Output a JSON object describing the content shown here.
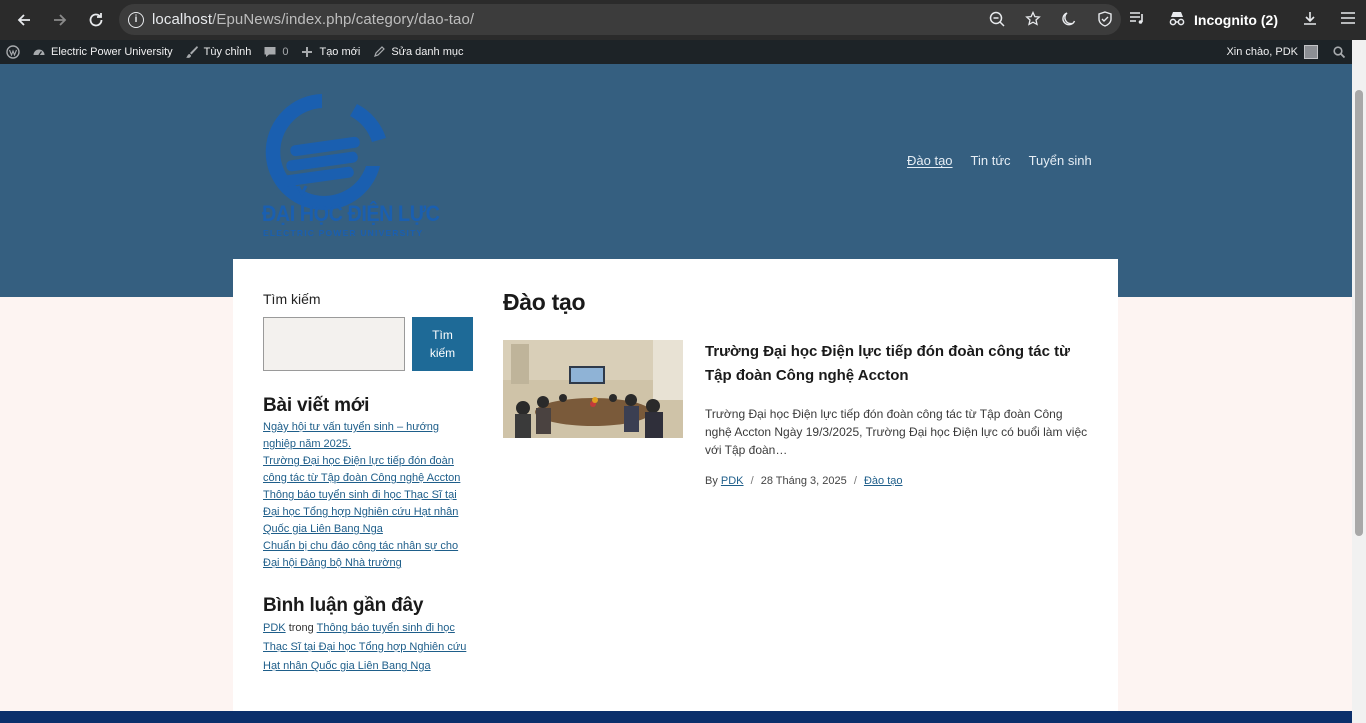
{
  "browser": {
    "url_host": "localhost",
    "url_path": "/EpuNews/index.php/category/dao-tao/",
    "incognito_label": "Incognito (2)"
  },
  "adminbar": {
    "site_name": "Electric Power University",
    "customize": "Tùy chỉnh",
    "comments_count": "0",
    "new": "Tạo mới",
    "edit_category": "Sửa danh mục",
    "greeting": "Xin chào, PDK"
  },
  "header": {
    "logo_title": "ĐẠI HỌC ĐIỆN LỰC",
    "logo_subtitle": "ELECTRIC POWER UNIVERSITY",
    "nav": [
      "Đào tạo",
      "Tin tức",
      "Tuyển sinh"
    ]
  },
  "sidebar": {
    "search_label": "Tìm kiếm",
    "search_placeholder": "",
    "search_button": "Tìm kiếm",
    "recent_posts_title": "Bài viết mới",
    "recent_posts": [
      "Ngày hội tư vấn tuyển sinh – hướng nghiệp năm 2025.",
      "Trường Đại học Điện lực tiếp đón đoàn công tác từ Tập đoàn Công nghệ Accton",
      "Thông báo tuyển sinh đi học Thạc Sĩ tại Đại học Tổng hợp Nghiên cứu Hạt nhân Quốc gia Liên Bang Nga",
      "Chuẩn bị chu đáo công tác nhân sự cho Đại hội Đảng bộ Nhà trường"
    ],
    "recent_comments_title": "Bình luận gần đây",
    "comment_author": "PDK",
    "comment_in": "trong",
    "comment_post": "Thông báo tuyển sinh đi học Thạc Sĩ tại Đại học Tổng hợp Nghiên cứu Hạt nhân Quốc gia Liên Bang Nga"
  },
  "main": {
    "archive_title": "Đào tạo",
    "post": {
      "title": "Trường Đại học Điện lực tiếp đón đoàn công tác từ Tập đoàn Công nghệ Accton",
      "excerpt": "Trường Đại học Điện lực tiếp đón đoàn công tác từ Tập đoàn Công nghệ Accton Ngày 19/3/2025, Trường Đại học Điện lực có buổi làm việc với Tập đoàn…",
      "by": "By",
      "author": "PDK",
      "date": "28 Tháng 3, 2025",
      "category": "Đào tạo"
    }
  }
}
